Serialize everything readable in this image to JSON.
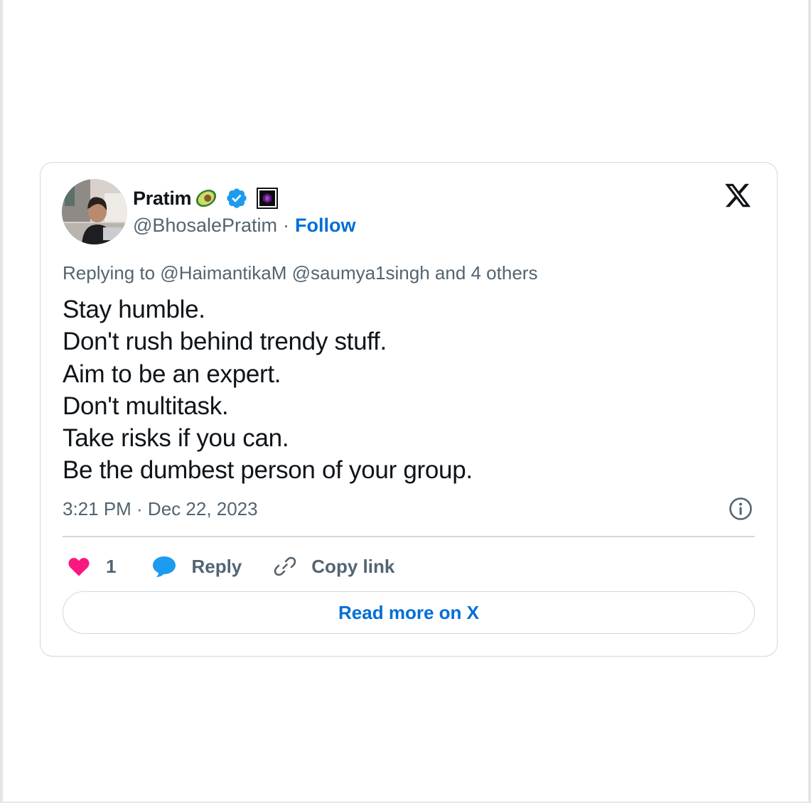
{
  "tweet": {
    "author_name": "Pratim",
    "name_emoji": "avocado-emoji-icon",
    "handle": "@BhosalePratim",
    "separator": "·",
    "follow_label": "Follow",
    "replying_to": "Replying to @HaimantikaM @saumya1singh and 4 others",
    "lines": [
      "Stay humble.",
      "Don't rush behind trendy stuff.",
      "Aim to be an expert.",
      "Don't multitask.",
      "Take risks if you can.",
      "Be the dumbest person of your group."
    ],
    "timestamp": "3:21 PM · Dec 22, 2023",
    "likes": "1",
    "reply_label": "Reply",
    "copy_link_label": "Copy link",
    "read_more_label": "Read more on X"
  },
  "colors": {
    "text_primary": "#0f1419",
    "text_secondary": "#536471",
    "link_blue": "#006fd6",
    "verified_blue": "#1d9bf0",
    "like_pink": "#f91880",
    "border": "#cfd9de"
  },
  "icons": {
    "platform_logo": "x-logo-icon",
    "verified": "verified-badge-icon",
    "affiliate": "affiliate-badge-icon",
    "info": "info-icon",
    "like": "heart-icon",
    "reply": "speech-bubble-icon",
    "copy": "link-icon"
  }
}
